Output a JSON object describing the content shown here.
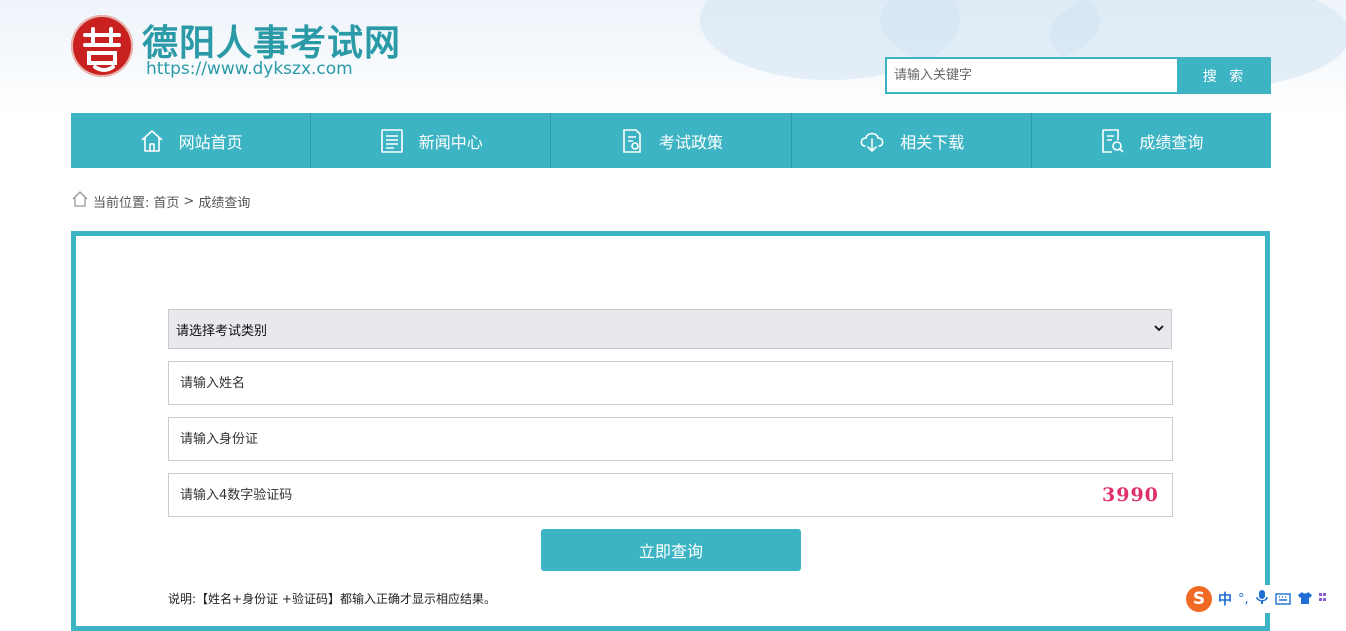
{
  "header": {
    "site_title": "德阳人事考试网",
    "site_url": "https://www.dykszx.com",
    "search_placeholder": "请输入关键字",
    "search_button": "搜 索"
  },
  "nav": {
    "items": [
      {
        "label": "网站首页",
        "icon": "home-icon"
      },
      {
        "label": "新闻中心",
        "icon": "news-icon"
      },
      {
        "label": "考试政策",
        "icon": "policy-document-icon"
      },
      {
        "label": "相关下载",
        "icon": "cloud-download-icon"
      },
      {
        "label": "成绩查询",
        "icon": "search-document-icon"
      }
    ]
  },
  "breadcrumb": {
    "prefix": "当前位置:",
    "home": "首页",
    "separator": ">",
    "current": "成绩查询"
  },
  "form": {
    "exam_type_selected": "请选择考试类别",
    "name_placeholder": "请输入姓名",
    "id_placeholder": "请输入身份证",
    "captcha_placeholder": "请输入4数字验证码",
    "captcha_image_text": "3990",
    "submit_label": "立即查询",
    "note": "说明:【姓名+身份证 +验证码】都输入正确才显示相应结果。"
  },
  "ime_toolbar": {
    "logo_letter": "S",
    "mode": "中",
    "punct": "°,"
  },
  "colors": {
    "accent": "#3db4c4",
    "title": "#2a9aa6",
    "seal": "#c8211f",
    "captcha": "#e0306a"
  }
}
